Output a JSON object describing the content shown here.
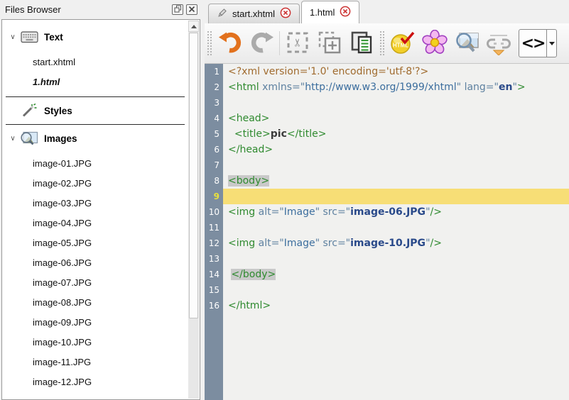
{
  "panel": {
    "title": "Files Browser",
    "buttons": [
      {
        "name": "float-panel-button",
        "icon": "float-icon"
      },
      {
        "name": "close-panel-button",
        "icon": "close-icon"
      }
    ],
    "sections": [
      {
        "label": "Text",
        "icon": "keyboard-icon",
        "expanded": true,
        "items": [
          "start.xhtml",
          "1.html"
        ],
        "active_item": "1.html"
      },
      {
        "label": "Styles",
        "icon": "wand-icon",
        "expanded": false,
        "items": []
      },
      {
        "label": "Images",
        "icon": "image-magnifier-icon",
        "expanded": true,
        "items": [
          "image-01.JPG",
          "image-02.JPG",
          "image-03.JPG",
          "image-04.JPG",
          "image-05.JPG",
          "image-06.JPG",
          "image-07.JPG",
          "image-08.JPG",
          "image-09.JPG",
          "image-10.JPG",
          "image-11.JPG",
          "image-12.JPG"
        ]
      }
    ]
  },
  "tabs": [
    {
      "label": "start.xhtml",
      "icon": "pencil-icon",
      "close_icon": "close-circle-icon",
      "active": false
    },
    {
      "label": "1.html",
      "icon": null,
      "close_icon": "close-circle-icon",
      "active": true
    }
  ],
  "toolbar": {
    "buttons": [
      {
        "name": "undo-button",
        "icon": "undo-icon"
      },
      {
        "name": "redo-button",
        "icon": "redo-icon"
      },
      {
        "name": "cut-button",
        "icon": "cut-icon"
      },
      {
        "name": "copy-button",
        "icon": "copy-icon"
      },
      {
        "name": "paste-button",
        "icon": "paste-icon"
      },
      {
        "name": "html-check-button",
        "icon": "html-badge-icon",
        "badge_text": "HTML"
      },
      {
        "name": "flower-button",
        "icon": "flower-icon"
      },
      {
        "name": "image-preview-button",
        "icon": "image-lens-icon"
      },
      {
        "name": "links-button",
        "icon": "broken-link-icon"
      },
      {
        "name": "source-view-button",
        "icon": "code-brackets-icon",
        "glyph": "<>",
        "has_dropdown": true
      }
    ]
  },
  "editor": {
    "active_line": 9,
    "colors": {
      "gutter_bg": "#7c8da0",
      "gutter_text": "#ffffff",
      "active_line_bg": "#f7de76",
      "active_line_number": "#e9e13c",
      "match_highlight_bg": "#c9c9c9",
      "code_bg": "#f1f1ef",
      "pi": "#a06b2e",
      "tag": "#2f8a2f",
      "attr": "#5e81a0",
      "value": "#3c6e9e",
      "value_bold": "#2a4a8a",
      "undo_accent": "#e2711d",
      "tab_close_red": "#cc3333"
    },
    "lines": [
      {
        "n": 1,
        "tokens": [
          {
            "t": "<?xml version='1.0' encoding='utf-8'?>",
            "c": "pi"
          }
        ]
      },
      {
        "n": 2,
        "tokens": [
          {
            "t": "<html",
            "c": "tag"
          },
          {
            "t": " ",
            "c": "plain"
          },
          {
            "t": "xmlns=\"",
            "c": "attr"
          },
          {
            "t": "http://www.w3.org/1999/xhtml",
            "c": "val"
          },
          {
            "t": "\"",
            "c": "attr"
          },
          {
            "t": " ",
            "c": "plain"
          },
          {
            "t": "lang=\"",
            "c": "attr"
          },
          {
            "t": "en",
            "c": "valb"
          },
          {
            "t": "\"",
            "c": "attr"
          },
          {
            "t": ">",
            "c": "tag"
          }
        ]
      },
      {
        "n": 3,
        "tokens": []
      },
      {
        "n": 4,
        "tokens": [
          {
            "t": "<head>",
            "c": "tag"
          }
        ]
      },
      {
        "n": 5,
        "tokens": [
          {
            "t": "  ",
            "c": "plain"
          },
          {
            "t": "<title>",
            "c": "tag"
          },
          {
            "t": "pic",
            "c": "btext"
          },
          {
            "t": "</title>",
            "c": "tag"
          }
        ]
      },
      {
        "n": 6,
        "tokens": [
          {
            "t": "</head>",
            "c": "tag"
          }
        ]
      },
      {
        "n": 7,
        "tokens": []
      },
      {
        "n": 8,
        "tokens": [
          {
            "t": "<body>",
            "c": "tag",
            "hl": true
          }
        ]
      },
      {
        "n": 9,
        "tokens": []
      },
      {
        "n": 10,
        "tokens": [
          {
            "t": "<img",
            "c": "tag"
          },
          {
            "t": " ",
            "c": "plain"
          },
          {
            "t": "alt=\"",
            "c": "attr"
          },
          {
            "t": "Image",
            "c": "val"
          },
          {
            "t": "\"",
            "c": "attr"
          },
          {
            "t": " ",
            "c": "plain"
          },
          {
            "t": "src=\"",
            "c": "attr"
          },
          {
            "t": "image-06.JPG",
            "c": "valb"
          },
          {
            "t": "\"",
            "c": "attr"
          },
          {
            "t": "/>",
            "c": "tag"
          }
        ]
      },
      {
        "n": 11,
        "tokens": []
      },
      {
        "n": 12,
        "tokens": [
          {
            "t": "<img",
            "c": "tag"
          },
          {
            "t": " ",
            "c": "plain"
          },
          {
            "t": "alt=\"",
            "c": "attr"
          },
          {
            "t": "Image",
            "c": "val"
          },
          {
            "t": "\"",
            "c": "attr"
          },
          {
            "t": " ",
            "c": "plain"
          },
          {
            "t": "src=\"",
            "c": "attr"
          },
          {
            "t": "image-10.JPG",
            "c": "valb"
          },
          {
            "t": "\"",
            "c": "attr"
          },
          {
            "t": "/>",
            "c": "tag"
          }
        ]
      },
      {
        "n": 13,
        "tokens": []
      },
      {
        "n": 14,
        "tokens": [
          {
            "t": " ",
            "c": "plain"
          },
          {
            "t": "</body>",
            "c": "tag",
            "hl": true
          }
        ]
      },
      {
        "n": 15,
        "tokens": []
      },
      {
        "n": 16,
        "tokens": [
          {
            "t": "</html>",
            "c": "tag"
          }
        ]
      }
    ]
  }
}
